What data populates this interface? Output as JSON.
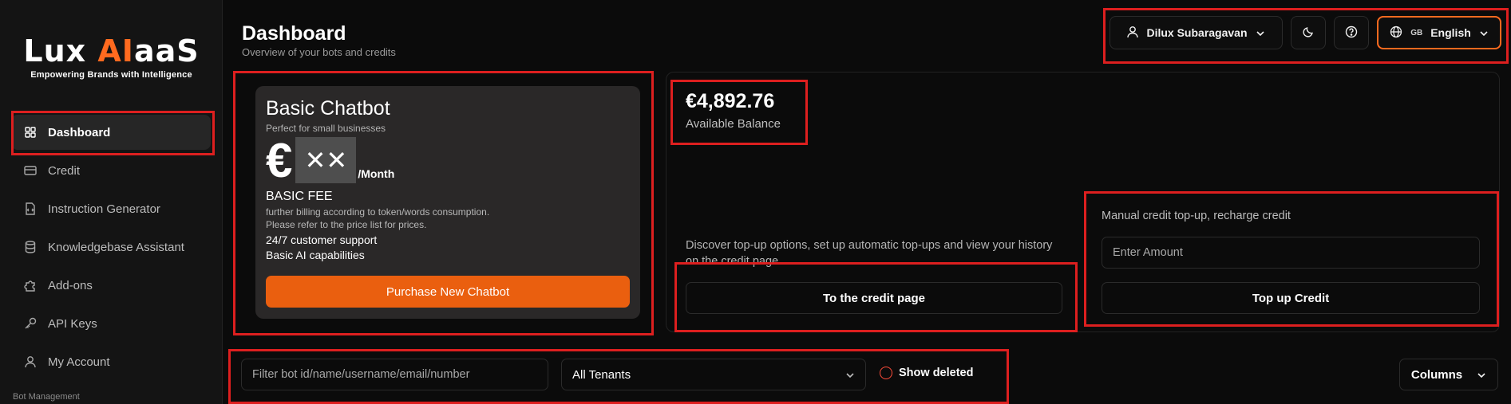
{
  "sidebar": {
    "logo": {
      "prefix": "Lux ",
      "accent": "AI",
      "suffix": "aaS",
      "tagline": "Empowering Brands with Intelligence"
    },
    "items": [
      {
        "label": "Dashboard",
        "icon": "dashboard-icon",
        "active": true
      },
      {
        "label": "Credit",
        "icon": "credit-card-icon"
      },
      {
        "label": "Instruction Generator",
        "icon": "document-code-icon"
      },
      {
        "label": "Knowledgebase Assistant",
        "icon": "database-icon"
      },
      {
        "label": "Add-ons",
        "icon": "puzzle-icon"
      },
      {
        "label": "API Keys",
        "icon": "key-icon"
      },
      {
        "label": "My Account",
        "icon": "user-icon"
      }
    ],
    "section_label": "Bot Management"
  },
  "header": {
    "title": "Dashboard",
    "subtitle": "Overview of your bots and credits",
    "user_name": "Dilux Subaragavan",
    "language_flag": "GB",
    "language": "English"
  },
  "plan": {
    "name": "Basic Chatbot",
    "description": "Perfect for small businesses",
    "currency": "€",
    "price_masked": "✕✕",
    "period": "/Month",
    "fee_title": "BASIC FEE",
    "fee_line1": "further billing according to token/words consumption.",
    "fee_line2": "Please refer to the price list for prices.",
    "features": [
      "24/7 customer support",
      "Basic AI capabilities"
    ],
    "purchase_label": "Purchase New Chatbot"
  },
  "credit": {
    "balance": "€4,892.76",
    "balance_label": "Available Balance",
    "info_text": "Discover top-up options, set up automatic top-ups and view your history on the credit page.",
    "credit_page_label": "To the credit page",
    "topup_label": "Manual credit top-up, recharge credit",
    "amount_placeholder": "Enter Amount",
    "topup_button": "Top up Credit"
  },
  "filters": {
    "search_placeholder": "Filter bot id/name/username/email/number",
    "tenant_selected": "All Tenants",
    "show_deleted_label": "Show deleted",
    "columns_label": "Columns"
  },
  "colors": {
    "accent": "#ea5f0f",
    "highlight": "#dd1f1f"
  }
}
